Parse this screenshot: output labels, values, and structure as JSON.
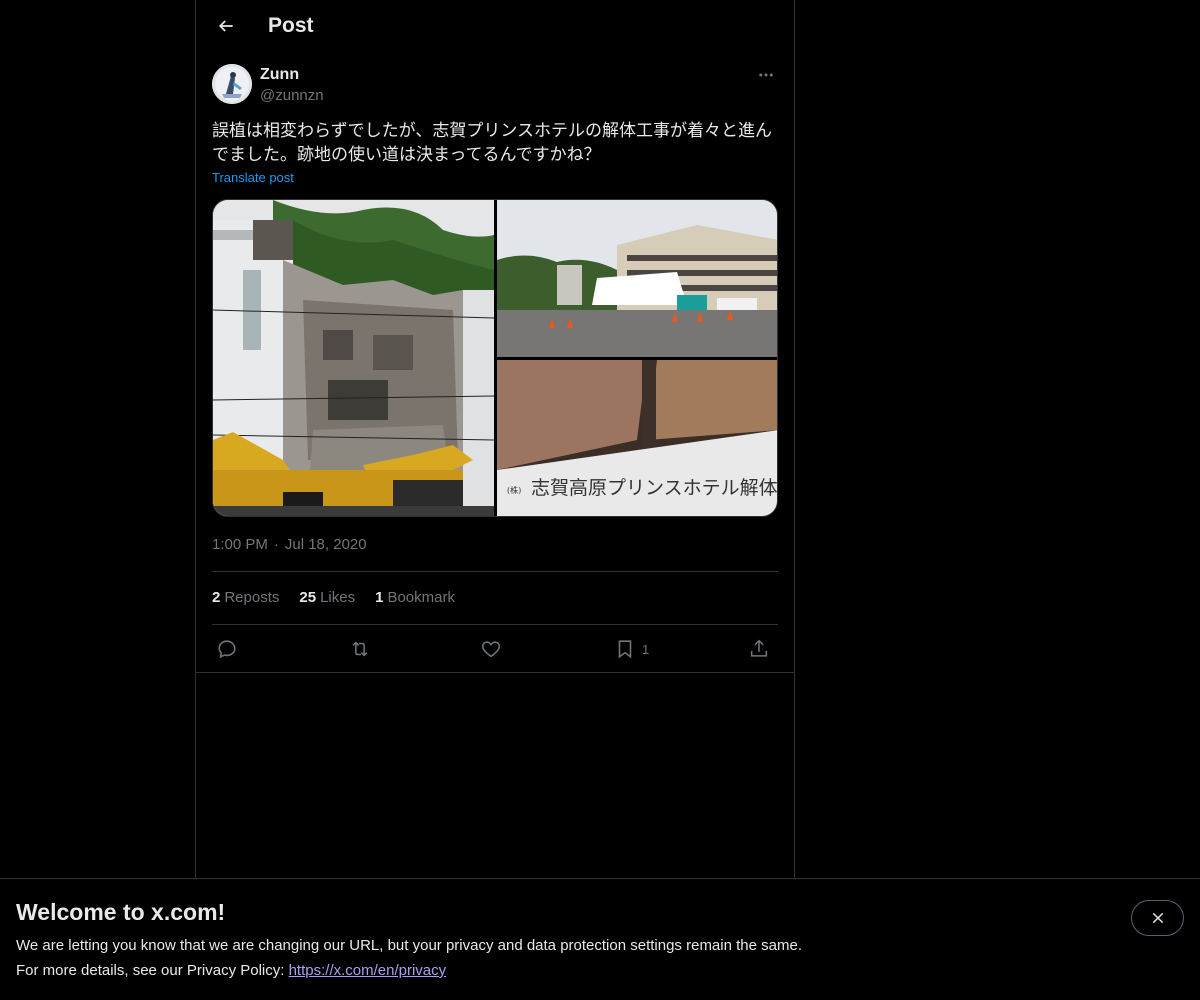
{
  "header": {
    "title": "Post"
  },
  "author": {
    "name": "Zunn",
    "handle": "@zunnzn"
  },
  "post": {
    "text": "誤植は相変わらずでしたが、志賀プリンスホテルの解体工事が着々と進んでました。跡地の使い道は決まってるんですかね？",
    "translate_label": "Translate post",
    "time": "1:00 PM",
    "separator": "·",
    "date": "Jul 18, 2020",
    "photo_sign_text": "志賀高原プリンスホテル解体工事"
  },
  "stats": {
    "reposts_count": "2",
    "reposts_label": "Reposts",
    "likes_count": "25",
    "likes_label": "Likes",
    "bookmarks_count": "1",
    "bookmarks_label": "Bookmark"
  },
  "actions": {
    "bookmark_count": "1"
  },
  "banner": {
    "title": "Welcome to x.com!",
    "line1": "We are letting you know that we are changing our URL, but your privacy and data protection settings remain the same.",
    "line2_prefix": "For more details, see our Privacy Policy: ",
    "link": "https://x.com/en/privacy"
  },
  "colors": {
    "background": "#000000",
    "text": "#e7e9ea",
    "muted": "#71767b",
    "accent": "#1d9bf0",
    "border": "#2f3336"
  },
  "icons": [
    "back-arrow-icon",
    "more-icon",
    "reply-icon",
    "repost-icon",
    "like-icon",
    "bookmark-icon",
    "share-icon",
    "close-icon"
  ]
}
